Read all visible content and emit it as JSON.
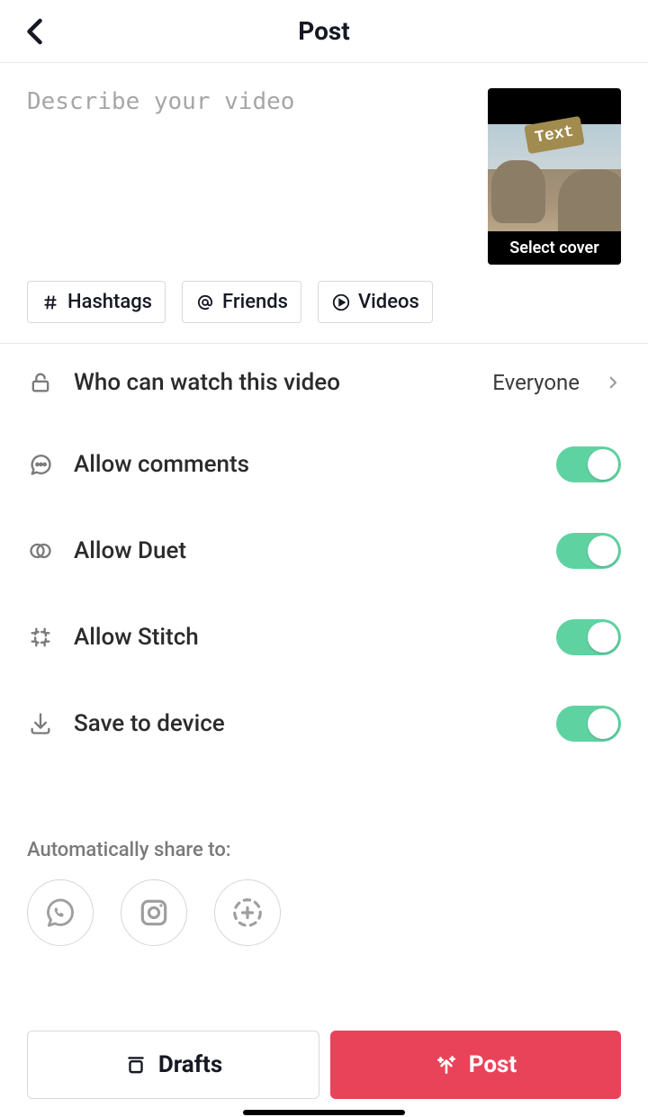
{
  "header": {
    "title": "Post"
  },
  "compose": {
    "placeholder": "Describe your video",
    "cover_sticker": "Text",
    "cover_label": "Select cover"
  },
  "chips": {
    "hashtags": "Hashtags",
    "friends": "Friends",
    "videos": "Videos"
  },
  "settings": {
    "privacy_label": "Who can watch this video",
    "privacy_value": "Everyone",
    "comments_label": "Allow comments",
    "duet_label": "Allow Duet",
    "stitch_label": "Allow Stitch",
    "save_label": "Save to device"
  },
  "share": {
    "label": "Automatically share to:"
  },
  "buttons": {
    "drafts": "Drafts",
    "post": "Post"
  }
}
